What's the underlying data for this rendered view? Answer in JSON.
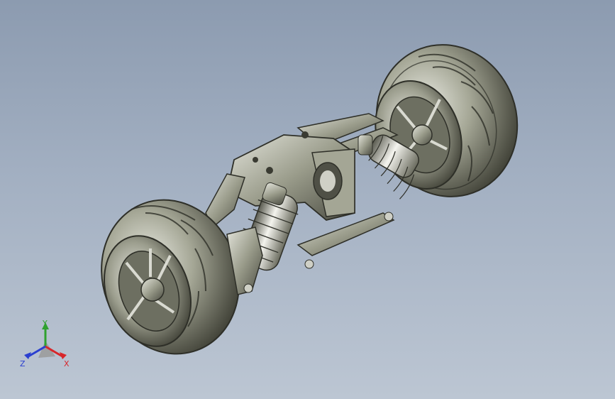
{
  "viewport": {
    "model": "suspension-axle-assembly",
    "background_top": "#8c9bb0",
    "background_bottom": "#bcc6d3",
    "part_color": "#8f9282",
    "highlight_color": "#e8e9e2",
    "shadow_color": "#2e2f28"
  },
  "triad": {
    "x_label": "X",
    "y_label": "Y",
    "z_label": "Z",
    "x_color": "#d8262a",
    "y_color": "#2fa12f",
    "z_color": "#2a3fd0"
  }
}
